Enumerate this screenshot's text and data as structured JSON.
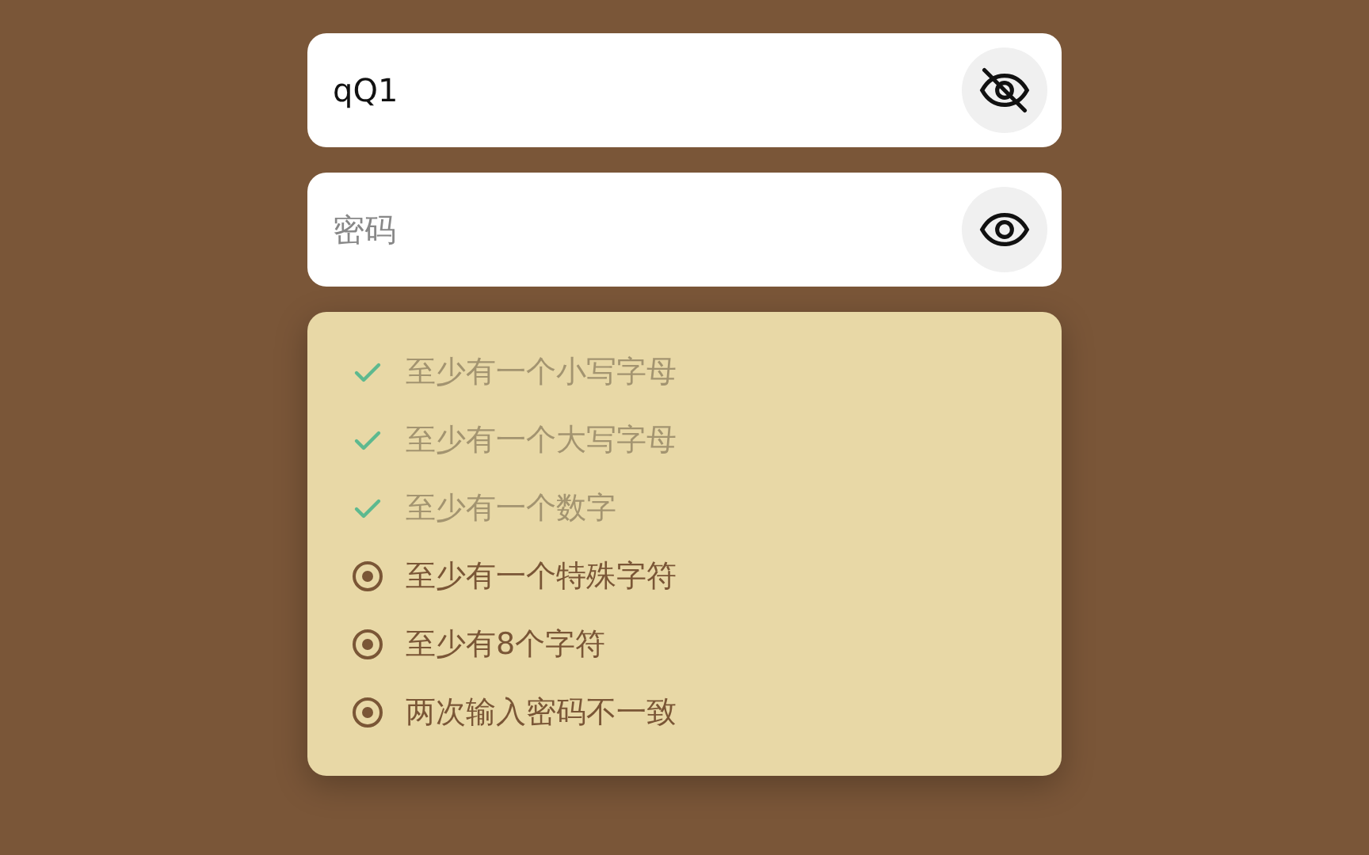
{
  "fields": [
    {
      "value": "qQ1",
      "show_password": true
    },
    {
      "placeholder": "密码",
      "show_password": false
    }
  ],
  "rules": [
    {
      "label": "至少有一个小写字母",
      "met": true
    },
    {
      "label": "至少有一个大写字母",
      "met": true
    },
    {
      "label": "至少有一个数字",
      "met": true
    },
    {
      "label": "至少有一个特殊字符",
      "met": false
    },
    {
      "label": "至少有8个字符",
      "met": false
    },
    {
      "label": "两次输入密码不一致",
      "met": false
    }
  ]
}
